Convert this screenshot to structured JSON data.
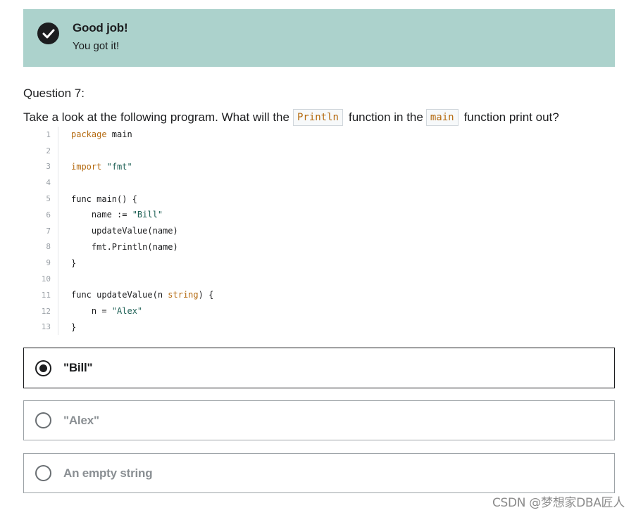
{
  "banner": {
    "title": "Good job!",
    "subtitle": "You got it!",
    "background": "#acd2cc",
    "icon": "check-circle-icon"
  },
  "question": {
    "label": "Question 7:",
    "text_before": "Take a look at the following program.  What will the",
    "code1": "Println",
    "text_middle": "function in the",
    "code2": "main",
    "text_after": "function print out?"
  },
  "code": {
    "lines": [
      {
        "num": "1",
        "text": "package main"
      },
      {
        "num": "2",
        "text": ""
      },
      {
        "num": "3",
        "text": "import \"fmt\""
      },
      {
        "num": "4",
        "text": ""
      },
      {
        "num": "5",
        "text": "func main() {"
      },
      {
        "num": "6",
        "text": "    name := \"Bill\""
      },
      {
        "num": "7",
        "text": "    updateValue(name)"
      },
      {
        "num": "8",
        "text": "    fmt.Println(name)"
      },
      {
        "num": "9",
        "text": "}"
      },
      {
        "num": "10",
        "text": ""
      },
      {
        "num": "11",
        "text": "func updateValue(n string) {"
      },
      {
        "num": "12",
        "text": "    n = \"Alex\""
      },
      {
        "num": "13",
        "text": "}"
      }
    ]
  },
  "options": [
    {
      "label": "\"Bill\"",
      "selected": true
    },
    {
      "label": "\"Alex\"",
      "selected": false
    },
    {
      "label": "An empty string",
      "selected": false
    }
  ],
  "watermark": "CSDN @梦想家DBA匠人"
}
